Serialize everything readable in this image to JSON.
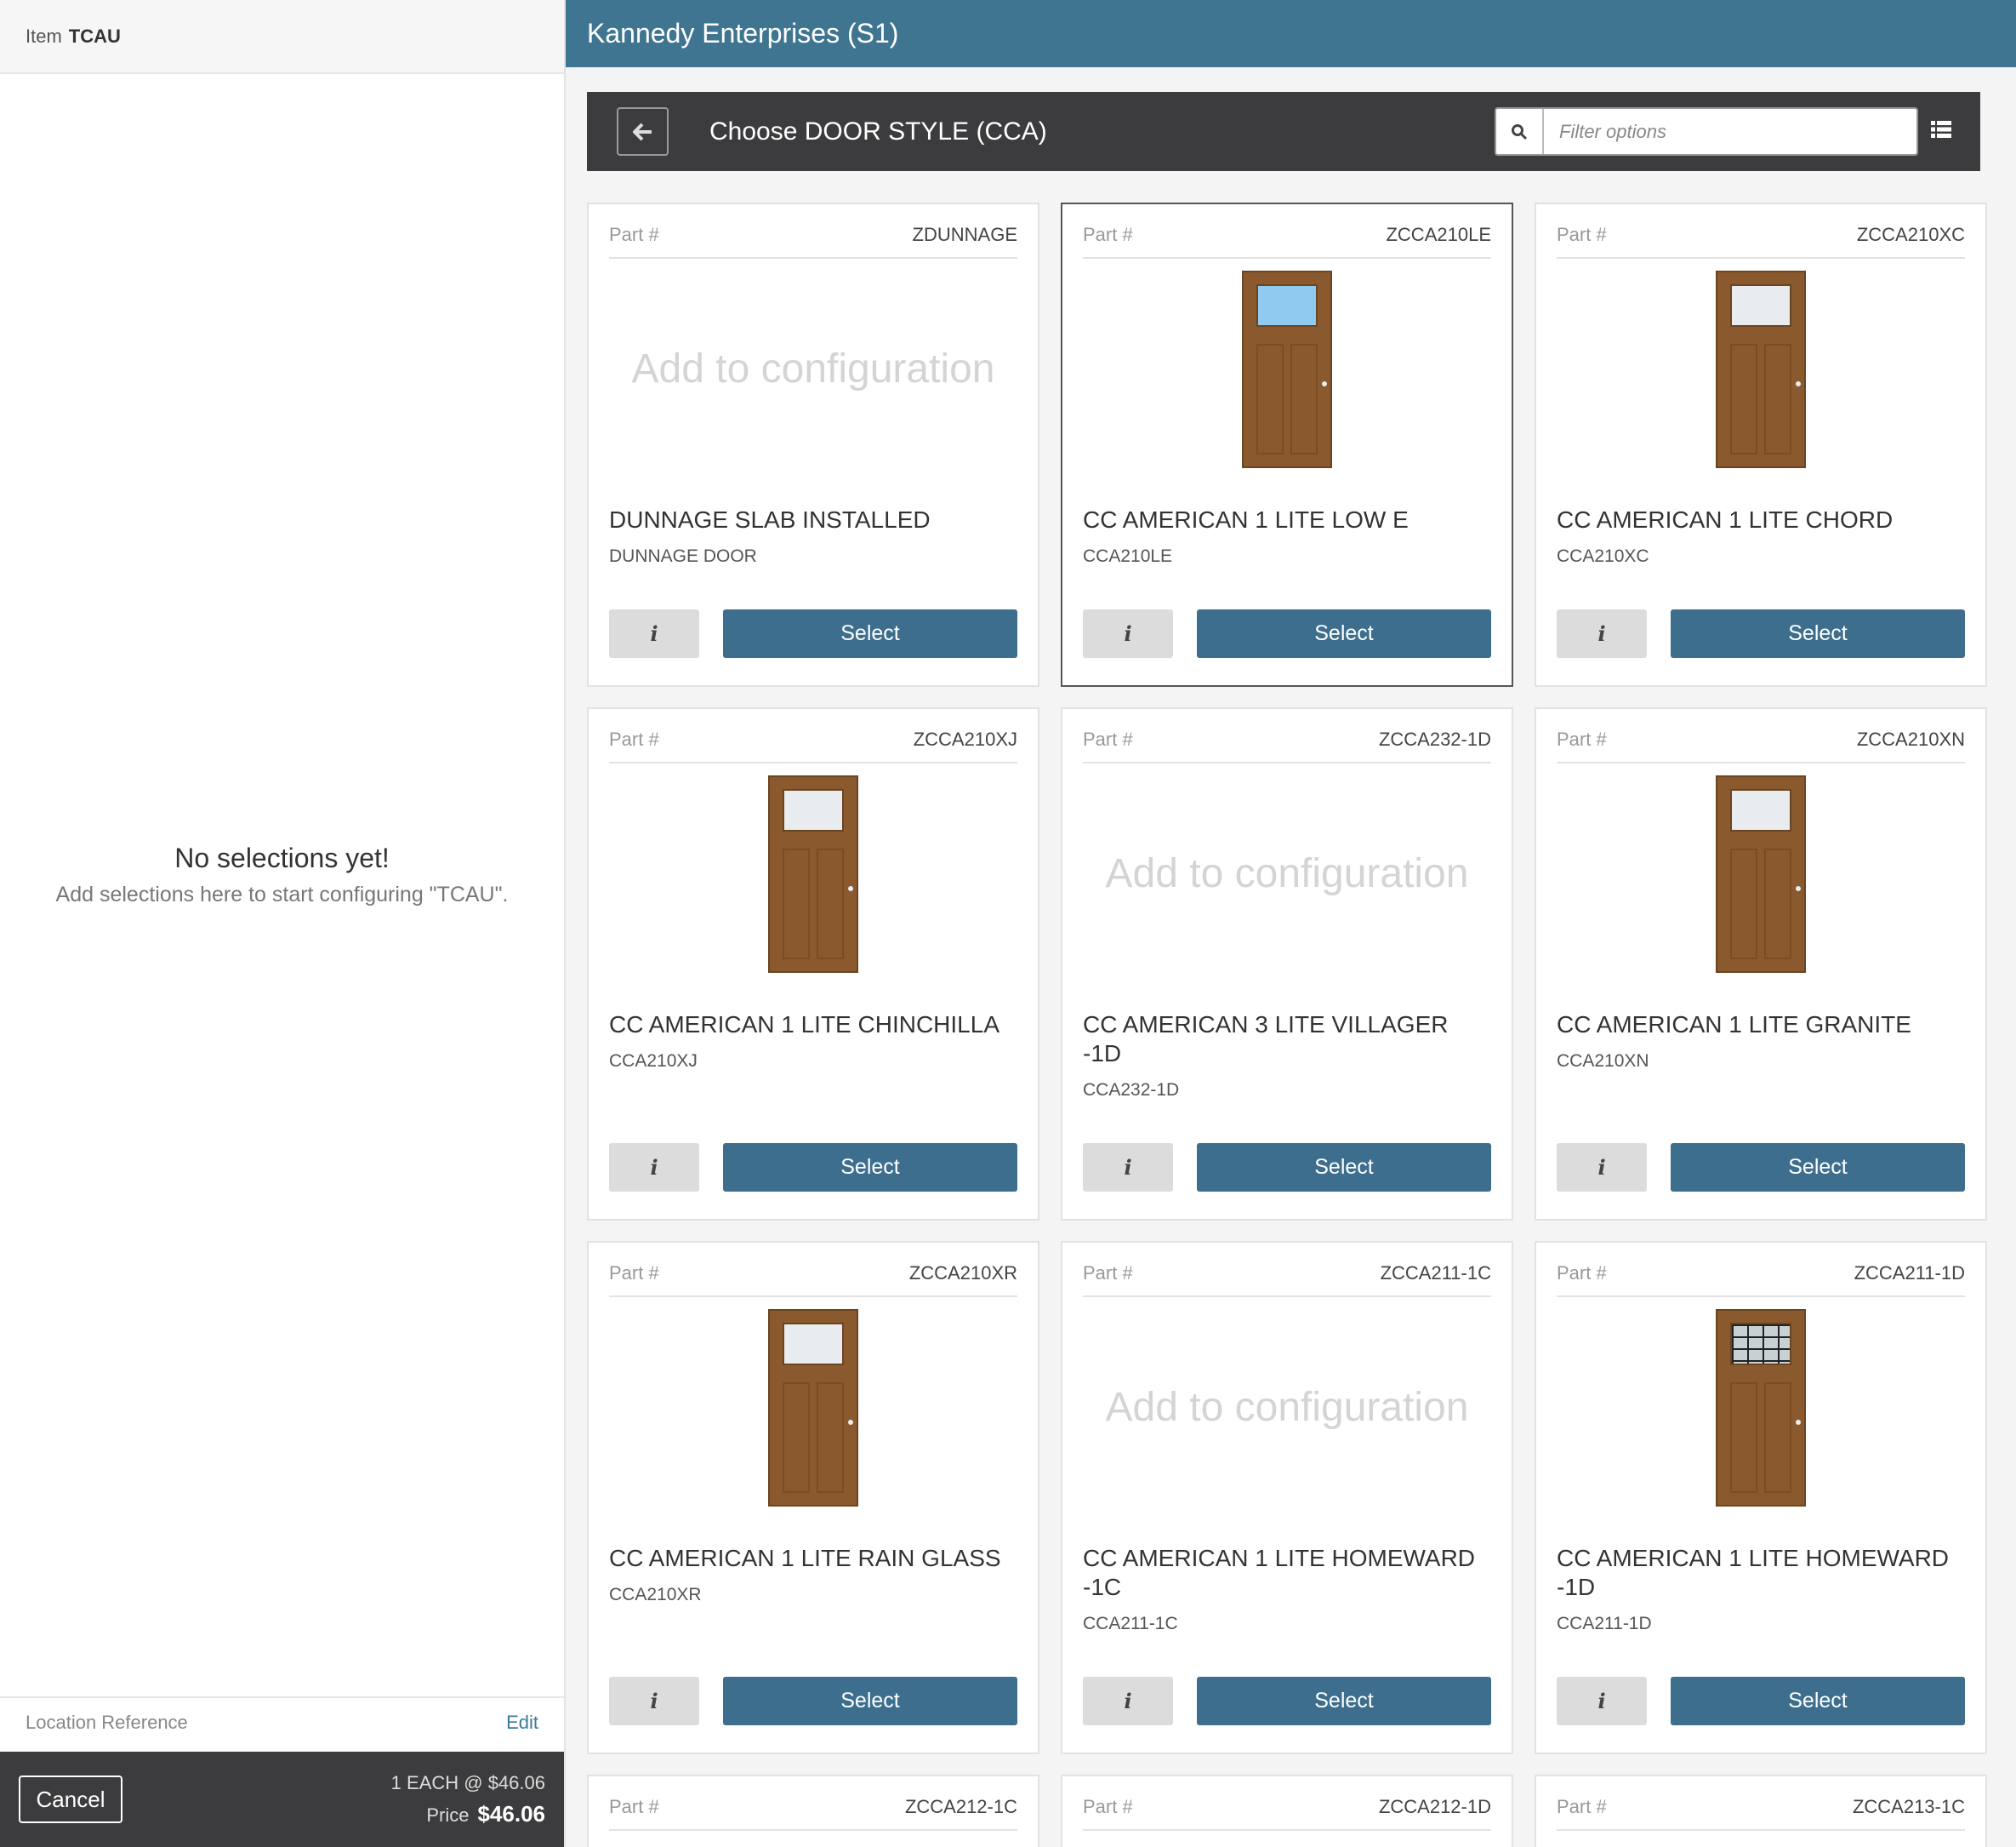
{
  "left": {
    "item_label": "Item",
    "item_code": "TCAU",
    "empty_title": "No selections yet!",
    "empty_sub": "Add selections here to start configuring \"TCAU\".",
    "location_label": "Location Reference",
    "edit_label": "Edit",
    "cancel_label": "Cancel",
    "qty_line": "1 EACH @ $46.06",
    "price_label": "Price",
    "price_value": "$46.06"
  },
  "header": {
    "title": "Kannedy Enterprises (S1)"
  },
  "chooser": {
    "title": "Choose DOOR STYLE (CCA)",
    "filter_placeholder": "Filter options"
  },
  "labels": {
    "part": "Part #",
    "add_to": "Add to configuration",
    "info": "i",
    "select": "Select"
  },
  "cards": [
    {
      "part": "ZDUNNAGE",
      "title": "DUNNAGE SLAB INSTALLED",
      "sub": "DUNNAGE DOOR",
      "image": "none"
    },
    {
      "part": "ZCCA210LE",
      "title": "CC AMERICAN 1 LITE LOW E",
      "sub": "CCA210LE",
      "image": "door-low-e"
    },
    {
      "part": "ZCCA210XC",
      "title": "CC AMERICAN 1 LITE CHORD",
      "sub": "CCA210XC",
      "image": "door-frosted"
    },
    {
      "part": "ZCCA210XJ",
      "title": "CC AMERICAN 1 LITE CHINCHILLA",
      "sub": "CCA210XJ",
      "image": "door-frosted"
    },
    {
      "part": "ZCCA232-1D",
      "title": "CC AMERICAN 3 LITE VILLAGER -1D",
      "sub": "CCA232-1D",
      "image": "none"
    },
    {
      "part": "ZCCA210XN",
      "title": "CC AMERICAN 1 LITE GRANITE",
      "sub": "CCA210XN",
      "image": "door-frosted"
    },
    {
      "part": "ZCCA210XR",
      "title": "CC AMERICAN 1 LITE RAIN GLASS",
      "sub": "CCA210XR",
      "image": "door-frosted"
    },
    {
      "part": "ZCCA211-1C",
      "title": "CC AMERICAN 1 LITE HOMEWARD -1C",
      "sub": "CCA211-1C",
      "image": "none"
    },
    {
      "part": "ZCCA211-1D",
      "title": "CC AMERICAN 1 LITE HOMEWARD -1D",
      "sub": "CCA211-1D",
      "image": "door-grid"
    },
    {
      "part": "ZCCA212-1C"
    },
    {
      "part": "ZCCA212-1D"
    },
    {
      "part": "ZCCA213-1C"
    }
  ]
}
